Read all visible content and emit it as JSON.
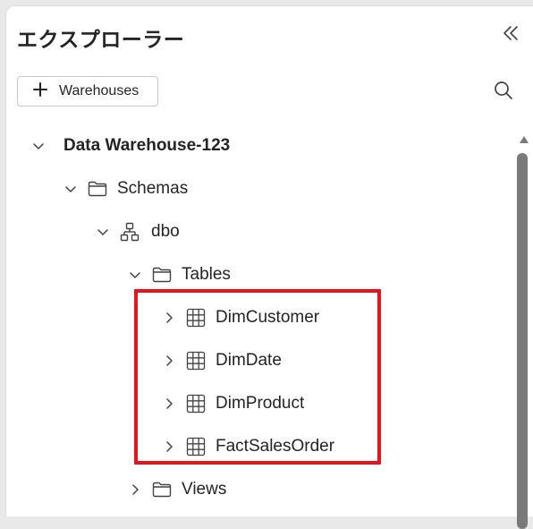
{
  "panel": {
    "title": "エクスプローラー",
    "add_button_label": "Warehouses"
  },
  "tree": {
    "root": "Data Warehouse-123",
    "schemas": "Schemas",
    "dbo": "dbo",
    "tables": "Tables",
    "table_items": [
      "DimCustomer",
      "DimDate",
      "DimProduct",
      "FactSalesOrder"
    ],
    "views": "Views"
  },
  "colors": {
    "highlight": "#e8141c",
    "text": "#242424",
    "scrollbar": "#7a7a7a"
  },
  "icons": {
    "collapse": "double-chevron-left-icon",
    "add": "plus-icon",
    "search": "search-icon",
    "folder": "folder-icon",
    "schema": "schema-icon",
    "table": "table-grid-icon"
  }
}
